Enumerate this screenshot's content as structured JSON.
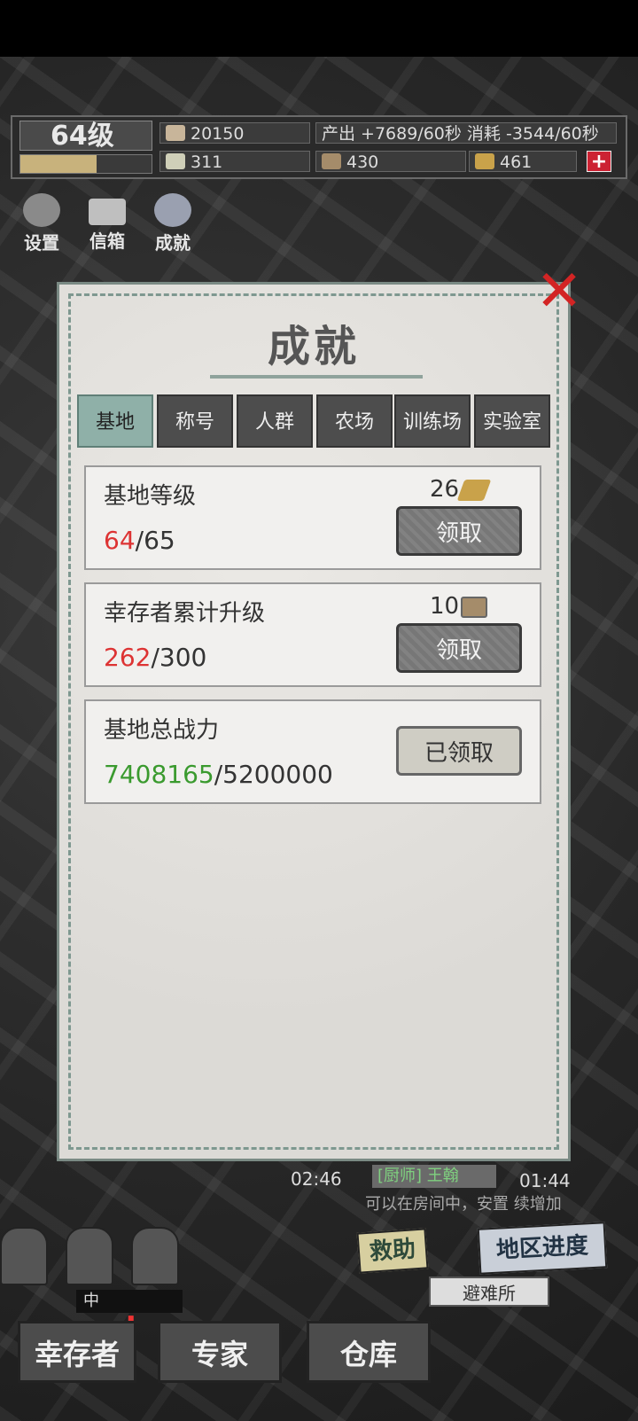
{
  "hud": {
    "level": "64级",
    "xp_progress": 0.58,
    "food": "20150",
    "production": "产出 +7689/60秒  消耗 -3544/60秒",
    "res_a": "311",
    "res_b": "430",
    "res_c": "461"
  },
  "side": {
    "settings": "设置",
    "mailbox": "信箱",
    "achievements": "成就"
  },
  "panel": {
    "title": "成就",
    "close": "✕",
    "tabs": [
      "基地",
      "称号",
      "人群",
      "农场",
      "训练场",
      "实验室"
    ],
    "items": [
      {
        "title": "基地等级",
        "current": "64",
        "target": "/65",
        "reward": "26",
        "button": "领取"
      },
      {
        "title": "幸存者累计升级",
        "current": "262",
        "target": "/300",
        "reward": "10",
        "button": "领取"
      },
      {
        "title": "基地总战力",
        "current": "7408165",
        "target": "/5200000",
        "button": "已领取"
      }
    ]
  },
  "background": {
    "timer1": "02:46",
    "timer2": "01:44",
    "chat_tag": "[厨师] 王翰",
    "notice": "可以在房间中，安置 续增加",
    "help": "救助",
    "region_progress": "地区进度",
    "shelter": "避难所",
    "mid_tag": "中",
    "nav": {
      "survivors": "幸存者",
      "experts": "专家",
      "warehouse": "仓库"
    },
    "warn_mark": "!"
  },
  "colors": {
    "active_tab": "#8fb0a8",
    "red": "#dd3333",
    "green": "#3a9a2e"
  }
}
